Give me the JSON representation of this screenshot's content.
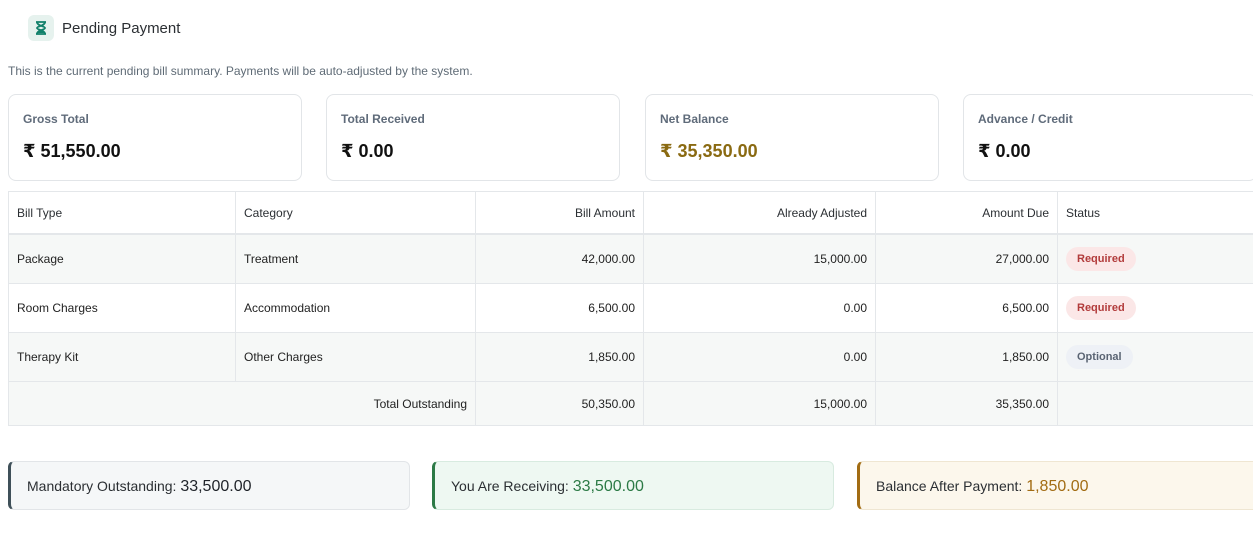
{
  "header": {
    "title": "Pending Payment",
    "icon": "hourglass-icon"
  },
  "subtitle": "This is the current pending bill summary. Payments will be auto-adjusted by the system.",
  "cards": [
    {
      "label": "Gross Total",
      "value": "₹ 51,550.00",
      "color": "#111111"
    },
    {
      "label": "Total Received",
      "value": "₹ 0.00",
      "color": "#111111"
    },
    {
      "label": "Net Balance",
      "value": "₹ 35,350.00",
      "color": "#8a6a12"
    },
    {
      "label": "Advance / Credit",
      "value": "₹ 0.00",
      "color": "#111111"
    }
  ],
  "table": {
    "columns": [
      "Bill Type",
      "Category",
      "Bill Amount",
      "Already Adjusted",
      "Amount Due",
      "Status"
    ],
    "rows": [
      {
        "bill_type": "Package",
        "category": "Treatment",
        "bill_amount": "42,000.00",
        "already_adjusted": "15,000.00",
        "amount_due": "27,000.00",
        "status": "Required"
      },
      {
        "bill_type": "Room Charges",
        "category": "Accommodation",
        "bill_amount": "6,500.00",
        "already_adjusted": "0.00",
        "amount_due": "6,500.00",
        "status": "Required"
      },
      {
        "bill_type": "Therapy Kit",
        "category": "Other Charges",
        "bill_amount": "1,850.00",
        "already_adjusted": "0.00",
        "amount_due": "1,850.00",
        "status": "Optional"
      }
    ],
    "total": {
      "label": "Total Outstanding",
      "bill_amount": "50,350.00",
      "already_adjusted": "15,000.00",
      "amount_due": "35,350.00"
    }
  },
  "summary": {
    "mandatory": {
      "label": "Mandatory Outstanding:",
      "value": "33,500.00",
      "color": "#1f2329"
    },
    "receiving": {
      "label": "You Are Receiving:",
      "value": "33,500.00",
      "color": "#2c7a46"
    },
    "balance": {
      "label": "Balance After Payment:",
      "value": "1,850.00",
      "color": "#a26c13"
    }
  }
}
